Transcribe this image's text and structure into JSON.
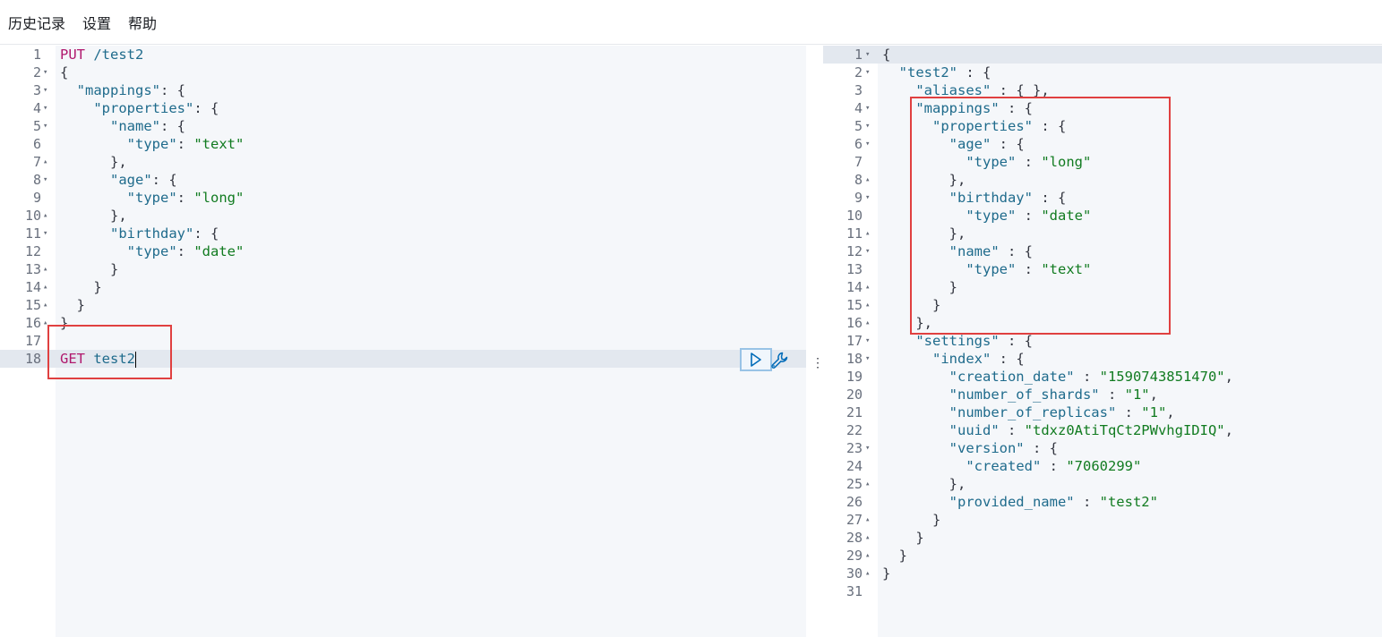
{
  "menu": {
    "history": "历史记录",
    "settings": "设置",
    "help": "帮助"
  },
  "request": {
    "lines": [
      {
        "n": "1",
        "fold": "",
        "code": [
          [
            "kw",
            "PUT "
          ],
          [
            "path",
            "/test2"
          ]
        ]
      },
      {
        "n": "2",
        "fold": "▾",
        "code": [
          [
            "k",
            "{"
          ]
        ]
      },
      {
        "n": "3",
        "fold": "▾",
        "code": [
          [
            "k",
            "  "
          ],
          [
            "key",
            "\"mappings\""
          ],
          [
            "k",
            ": {"
          ]
        ]
      },
      {
        "n": "4",
        "fold": "▾",
        "code": [
          [
            "k",
            "    "
          ],
          [
            "key",
            "\"properties\""
          ],
          [
            "k",
            ": {"
          ]
        ]
      },
      {
        "n": "5",
        "fold": "▾",
        "code": [
          [
            "k",
            "      "
          ],
          [
            "key",
            "\"name\""
          ],
          [
            "k",
            ": {"
          ]
        ]
      },
      {
        "n": "6",
        "fold": "",
        "code": [
          [
            "k",
            "        "
          ],
          [
            "key",
            "\"type\""
          ],
          [
            "k",
            ": "
          ],
          [
            "str",
            "\"text\""
          ]
        ]
      },
      {
        "n": "7",
        "fold": "▴",
        "code": [
          [
            "k",
            "      },"
          ]
        ]
      },
      {
        "n": "8",
        "fold": "▾",
        "code": [
          [
            "k",
            "      "
          ],
          [
            "key",
            "\"age\""
          ],
          [
            "k",
            ": {"
          ]
        ]
      },
      {
        "n": "9",
        "fold": "",
        "code": [
          [
            "k",
            "        "
          ],
          [
            "key",
            "\"type\""
          ],
          [
            "k",
            ": "
          ],
          [
            "str",
            "\"long\""
          ]
        ]
      },
      {
        "n": "10",
        "fold": "▴",
        "code": [
          [
            "k",
            "      },"
          ]
        ]
      },
      {
        "n": "11",
        "fold": "▾",
        "code": [
          [
            "k",
            "      "
          ],
          [
            "key",
            "\"birthday\""
          ],
          [
            "k",
            ": {"
          ]
        ]
      },
      {
        "n": "12",
        "fold": "",
        "code": [
          [
            "k",
            "        "
          ],
          [
            "key",
            "\"type\""
          ],
          [
            "k",
            ": "
          ],
          [
            "str",
            "\"date\""
          ]
        ]
      },
      {
        "n": "13",
        "fold": "▴",
        "code": [
          [
            "k",
            "      }"
          ]
        ]
      },
      {
        "n": "14",
        "fold": "▴",
        "code": [
          [
            "k",
            "    }"
          ]
        ]
      },
      {
        "n": "15",
        "fold": "▴",
        "code": [
          [
            "k",
            "  }"
          ]
        ]
      },
      {
        "n": "16",
        "fold": "▴",
        "code": [
          [
            "k",
            "}"
          ]
        ]
      },
      {
        "n": "17",
        "fold": "",
        "code": []
      },
      {
        "n": "18",
        "fold": "",
        "code": [
          [
            "kw",
            "GET "
          ],
          [
            "path",
            "test2"
          ]
        ],
        "active": true
      }
    ]
  },
  "response": {
    "lines": [
      {
        "n": "1",
        "fold": "▾",
        "code": [
          [
            "k",
            "{"
          ]
        ],
        "active": true
      },
      {
        "n": "2",
        "fold": "▾",
        "code": [
          [
            "k",
            "  "
          ],
          [
            "key",
            "\"test2\""
          ],
          [
            "k",
            " : {"
          ]
        ]
      },
      {
        "n": "3",
        "fold": "",
        "code": [
          [
            "k",
            "    "
          ],
          [
            "key",
            "\"aliases\""
          ],
          [
            "k",
            " : { },"
          ]
        ]
      },
      {
        "n": "4",
        "fold": "▾",
        "code": [
          [
            "k",
            "    "
          ],
          [
            "key",
            "\"mappings\""
          ],
          [
            "k",
            " : {"
          ]
        ]
      },
      {
        "n": "5",
        "fold": "▾",
        "code": [
          [
            "k",
            "      "
          ],
          [
            "key",
            "\"properties\""
          ],
          [
            "k",
            " : {"
          ]
        ]
      },
      {
        "n": "6",
        "fold": "▾",
        "code": [
          [
            "k",
            "        "
          ],
          [
            "key",
            "\"age\""
          ],
          [
            "k",
            " : {"
          ]
        ]
      },
      {
        "n": "7",
        "fold": "",
        "code": [
          [
            "k",
            "          "
          ],
          [
            "key",
            "\"type\""
          ],
          [
            "k",
            " : "
          ],
          [
            "str",
            "\"long\""
          ]
        ]
      },
      {
        "n": "8",
        "fold": "▴",
        "code": [
          [
            "k",
            "        },"
          ]
        ]
      },
      {
        "n": "9",
        "fold": "▾",
        "code": [
          [
            "k",
            "        "
          ],
          [
            "key",
            "\"birthday\""
          ],
          [
            "k",
            " : {"
          ]
        ]
      },
      {
        "n": "10",
        "fold": "",
        "code": [
          [
            "k",
            "          "
          ],
          [
            "key",
            "\"type\""
          ],
          [
            "k",
            " : "
          ],
          [
            "str",
            "\"date\""
          ]
        ]
      },
      {
        "n": "11",
        "fold": "▴",
        "code": [
          [
            "k",
            "        },"
          ]
        ]
      },
      {
        "n": "12",
        "fold": "▾",
        "code": [
          [
            "k",
            "        "
          ],
          [
            "key",
            "\"name\""
          ],
          [
            "k",
            " : {"
          ]
        ]
      },
      {
        "n": "13",
        "fold": "",
        "code": [
          [
            "k",
            "          "
          ],
          [
            "key",
            "\"type\""
          ],
          [
            "k",
            " : "
          ],
          [
            "str",
            "\"text\""
          ]
        ]
      },
      {
        "n": "14",
        "fold": "▴",
        "code": [
          [
            "k",
            "        }"
          ]
        ]
      },
      {
        "n": "15",
        "fold": "▴",
        "code": [
          [
            "k",
            "      }"
          ]
        ]
      },
      {
        "n": "16",
        "fold": "▴",
        "code": [
          [
            "k",
            "    },"
          ]
        ]
      },
      {
        "n": "17",
        "fold": "▾",
        "code": [
          [
            "k",
            "    "
          ],
          [
            "key",
            "\"settings\""
          ],
          [
            "k",
            " : {"
          ]
        ]
      },
      {
        "n": "18",
        "fold": "▾",
        "code": [
          [
            "k",
            "      "
          ],
          [
            "key",
            "\"index\""
          ],
          [
            "k",
            " : {"
          ]
        ]
      },
      {
        "n": "19",
        "fold": "",
        "code": [
          [
            "k",
            "        "
          ],
          [
            "key",
            "\"creation_date\""
          ],
          [
            "k",
            " : "
          ],
          [
            "str",
            "\"1590743851470\""
          ],
          [
            "k",
            ","
          ]
        ]
      },
      {
        "n": "20",
        "fold": "",
        "code": [
          [
            "k",
            "        "
          ],
          [
            "key",
            "\"number_of_shards\""
          ],
          [
            "k",
            " : "
          ],
          [
            "str",
            "\"1\""
          ],
          [
            "k",
            ","
          ]
        ]
      },
      {
        "n": "21",
        "fold": "",
        "code": [
          [
            "k",
            "        "
          ],
          [
            "key",
            "\"number_of_replicas\""
          ],
          [
            "k",
            " : "
          ],
          [
            "str",
            "\"1\""
          ],
          [
            "k",
            ","
          ]
        ]
      },
      {
        "n": "22",
        "fold": "",
        "code": [
          [
            "k",
            "        "
          ],
          [
            "key",
            "\"uuid\""
          ],
          [
            "k",
            " : "
          ],
          [
            "str",
            "\"tdxz0AtiTqCt2PWvhgIDIQ\""
          ],
          [
            "k",
            ","
          ]
        ]
      },
      {
        "n": "23",
        "fold": "▾",
        "code": [
          [
            "k",
            "        "
          ],
          [
            "key",
            "\"version\""
          ],
          [
            "k",
            " : {"
          ]
        ]
      },
      {
        "n": "24",
        "fold": "",
        "code": [
          [
            "k",
            "          "
          ],
          [
            "key",
            "\"created\""
          ],
          [
            "k",
            " : "
          ],
          [
            "str",
            "\"7060299\""
          ]
        ]
      },
      {
        "n": "25",
        "fold": "▴",
        "code": [
          [
            "k",
            "        },"
          ]
        ]
      },
      {
        "n": "26",
        "fold": "",
        "code": [
          [
            "k",
            "        "
          ],
          [
            "key",
            "\"provided_name\""
          ],
          [
            "k",
            " : "
          ],
          [
            "str",
            "\"test2\""
          ]
        ]
      },
      {
        "n": "27",
        "fold": "▴",
        "code": [
          [
            "k",
            "      }"
          ]
        ]
      },
      {
        "n": "28",
        "fold": "▴",
        "code": [
          [
            "k",
            "    }"
          ]
        ]
      },
      {
        "n": "29",
        "fold": "▴",
        "code": [
          [
            "k",
            "  }"
          ]
        ]
      },
      {
        "n": "30",
        "fold": "▴",
        "code": [
          [
            "k",
            "}"
          ]
        ]
      },
      {
        "n": "31",
        "fold": "",
        "code": []
      }
    ]
  },
  "icons": {
    "run": "play-icon",
    "settings_wrench": "wrench-icon",
    "splitter": "vertical-dots-icon"
  },
  "colors": {
    "keyword": "#b0186d",
    "string": "#117b20",
    "key": "#1f6b8c",
    "highlight": "#e04040"
  }
}
